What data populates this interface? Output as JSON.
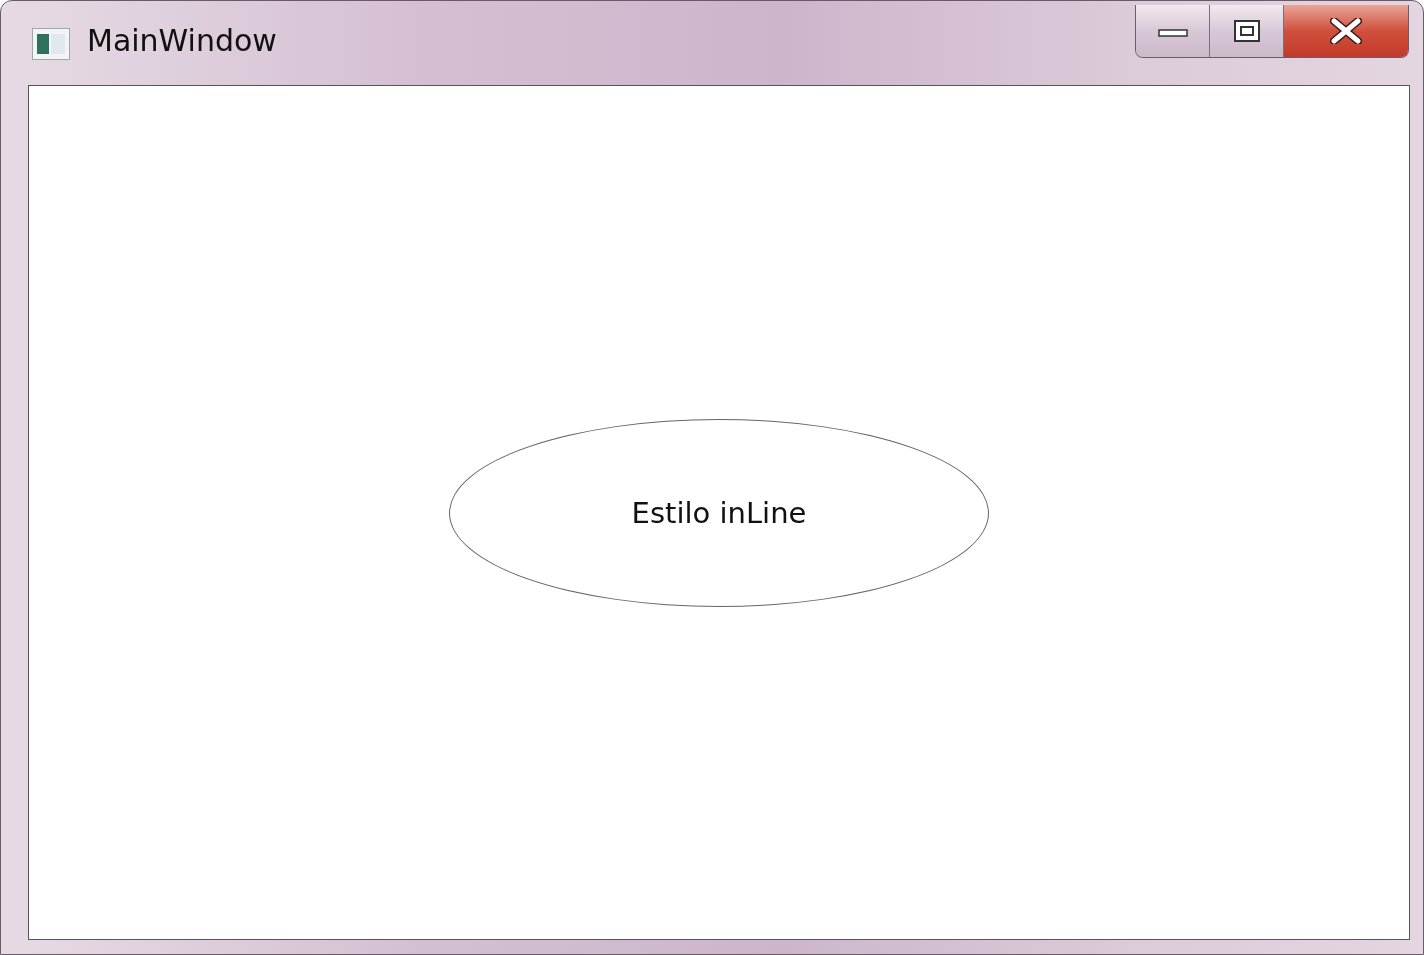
{
  "window": {
    "title": "MainWindow"
  },
  "ellipse": {
    "label": "Estilo inLine"
  }
}
